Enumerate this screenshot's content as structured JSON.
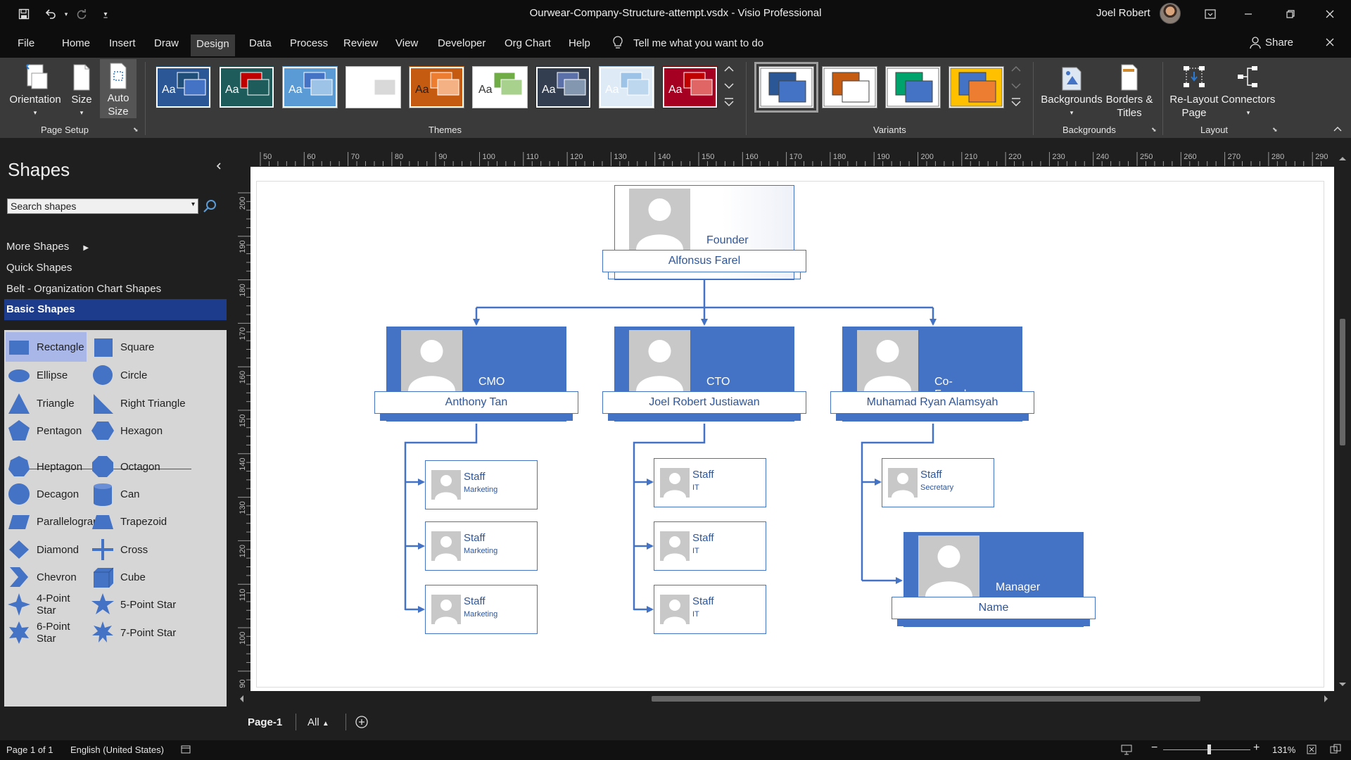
{
  "window": {
    "title": "Ourwear-Company-Structure-attempt.vsdx  -  Visio Professional",
    "user_name": "Joel Robert",
    "quick_access": [
      "save-icon",
      "undo-icon",
      "redo-icon",
      "customize-qat-icon"
    ],
    "controls": [
      "ribbon-display-icon",
      "minimize-icon",
      "restore-icon",
      "close-icon"
    ]
  },
  "menu": {
    "tabs": [
      "File",
      "Home",
      "Insert",
      "Draw",
      "Design",
      "Data",
      "Process",
      "Review",
      "View",
      "Developer",
      "Org Chart",
      "Help"
    ],
    "active": "Design",
    "tell_me": "Tell me what you want to do",
    "share": "Share"
  },
  "ribbon": {
    "page_setup": {
      "label": "Page Setup",
      "orientation": "Orientation",
      "size": "Size",
      "auto_size_line1": "Auto",
      "auto_size_line2": "Size"
    },
    "themes": {
      "label": "Themes",
      "items": [
        {
          "bg": "#2b5797",
          "fg": "#1f4e79",
          "accent": "#4472c4",
          "text": "Aa",
          "textColor": "#ffffff",
          "frame": "#1f4e79"
        },
        {
          "bg": "#1e5c5c",
          "fg": "#c00000",
          "accent": "#1e5c5c",
          "text": "Aa",
          "textColor": "#ffffff",
          "frame": "#144848"
        },
        {
          "bg": "#5b9bd5",
          "fg": "#4472c4",
          "accent": "#9dc3e6",
          "text": "Aa",
          "textColor": "#ffffff",
          "frame": "#5b9bd5"
        },
        {
          "bg": "#ffffff",
          "fg": "#ffffff",
          "accent": "#d9d9d9",
          "text": "",
          "textColor": "#333333",
          "frame": "#bfbfbf"
        },
        {
          "bg": "#c55a11",
          "fg": "#ed7d31",
          "accent": "#f4b183",
          "text": "Aa",
          "textColor": "#1f1f1f",
          "frame": "#c55a11"
        },
        {
          "bg": "#ffffff",
          "fg": "#70ad47",
          "accent": "#a9d18e",
          "text": "Aa",
          "textColor": "#333333",
          "frame": "#bfbfbf"
        },
        {
          "bg": "#333f50",
          "fg": "#5b6fa8",
          "accent": "#8497b0",
          "text": "Aa",
          "textColor": "#ffffff",
          "frame": "#222a35"
        },
        {
          "bg": "#deebf7",
          "fg": "#9dc3e6",
          "accent": "#bdd7ee",
          "text": "Aa",
          "textColor": "#ffffff",
          "frame": "#9dc3e6"
        },
        {
          "bg": "#a50021",
          "fg": "#c00000",
          "accent": "#e06666",
          "text": "Aa",
          "textColor": "#ffffff",
          "frame": "#7f0000"
        }
      ]
    },
    "variants": {
      "label": "Variants",
      "items": [
        {
          "back": "#2b5797",
          "front": "#4472c4",
          "bg": "#ffffff",
          "selected": true
        },
        {
          "back": "#c55a11",
          "front": "#ffffff",
          "bg": "#ffffff",
          "selected": false
        },
        {
          "back": "#00a36c",
          "front": "#4472c4",
          "bg": "#ffffff",
          "selected": false
        },
        {
          "back": "#4472c4",
          "front": "#ed7d31",
          "bg": "#ffc000",
          "selected": false
        }
      ]
    },
    "backgrounds": {
      "label": "Backgrounds",
      "backgrounds": "Backgrounds",
      "borders_line1": "Borders &",
      "borders_line2": "Titles"
    },
    "layout": {
      "label": "Layout",
      "relayout_line1": "Re-Layout",
      "relayout_line2": "Page",
      "connectors": "Connectors"
    }
  },
  "shapes_pane": {
    "title": "Shapes",
    "search_placeholder": "Search shapes",
    "links": [
      "More Shapes",
      "Quick Shapes",
      "Belt - Organization Chart Shapes"
    ],
    "active_stencil": "Basic Shapes",
    "shapes": [
      {
        "label": "Rectangle",
        "icon": "rectangle-icon"
      },
      {
        "label": "Square",
        "icon": "square-icon"
      },
      {
        "label": "Ellipse",
        "icon": "ellipse-icon"
      },
      {
        "label": "Circle",
        "icon": "circle-icon"
      },
      {
        "label": "Triangle",
        "icon": "triangle-icon"
      },
      {
        "label": "Right Triangle",
        "icon": "right-triangle-icon"
      },
      {
        "label": "Pentagon",
        "icon": "pentagon-icon"
      },
      {
        "label": "Hexagon",
        "icon": "hexagon-icon"
      },
      {
        "label": "Heptagon",
        "icon": "heptagon-icon"
      },
      {
        "label": "Octagon",
        "icon": "octagon-icon"
      },
      {
        "label": "Decagon",
        "icon": "decagon-icon"
      },
      {
        "label": "Can",
        "icon": "can-icon"
      },
      {
        "label": "Parallelogram",
        "icon": "parallelogram-icon"
      },
      {
        "label": "Trapezoid",
        "icon": "trapezoid-icon"
      },
      {
        "label": "Diamond",
        "icon": "diamond-icon"
      },
      {
        "label": "Cross",
        "icon": "cross-icon"
      },
      {
        "label": "Chevron",
        "icon": "chevron-icon"
      },
      {
        "label": "Cube",
        "icon": "cube-icon"
      },
      {
        "label": "4-Point Star",
        "icon": "4-point-star-icon"
      },
      {
        "label": "5-Point Star",
        "icon": "5-point-star-icon"
      },
      {
        "label": "6-Point Star",
        "icon": "6-point-star-icon"
      },
      {
        "label": "7-Point Star",
        "icon": "7-point-star-icon"
      }
    ]
  },
  "rulers": {
    "top": [
      "50",
      "60",
      "70",
      "80",
      "90",
      "100",
      "110",
      "120",
      "130",
      "140",
      "150",
      "160",
      "170",
      "180",
      "190",
      "200",
      "210",
      "220",
      "230",
      "240",
      "250",
      "260",
      "270",
      "280",
      "290"
    ],
    "left": [
      "200",
      "190",
      "180",
      "170",
      "160",
      "150",
      "140",
      "130",
      "120",
      "110",
      "100",
      "90"
    ]
  },
  "org_chart": {
    "founder": {
      "role": "Founder",
      "name": "Alfonsus Farel"
    },
    "cmo": {
      "role": "CMO",
      "name": "Anthony Tan"
    },
    "cto": {
      "role": "CTO",
      "name": "Joel Robert Justiawan"
    },
    "cofounder": {
      "role": "Co-Founder",
      "name": "Muhamad Ryan Alamsyah"
    },
    "manager": {
      "role": "Manager",
      "name": "Name"
    },
    "staff": [
      {
        "title": "Staff",
        "dept": "Marketing"
      },
      {
        "title": "Staff",
        "dept": "Marketing"
      },
      {
        "title": "Staff",
        "dept": "Marketing"
      },
      {
        "title": "Staff",
        "dept": "IT"
      },
      {
        "title": "Staff",
        "dept": "IT"
      },
      {
        "title": "Staff",
        "dept": "IT"
      },
      {
        "title": "Staff",
        "dept": "Secretary"
      }
    ],
    "colors": {
      "primary": "#4472c4",
      "text": "#2f5597"
    }
  },
  "page_tabs": {
    "current": "Page-1",
    "all": "All"
  },
  "status": {
    "page": "Page 1 of 1",
    "language": "English (United States)",
    "zoom": "131%"
  }
}
